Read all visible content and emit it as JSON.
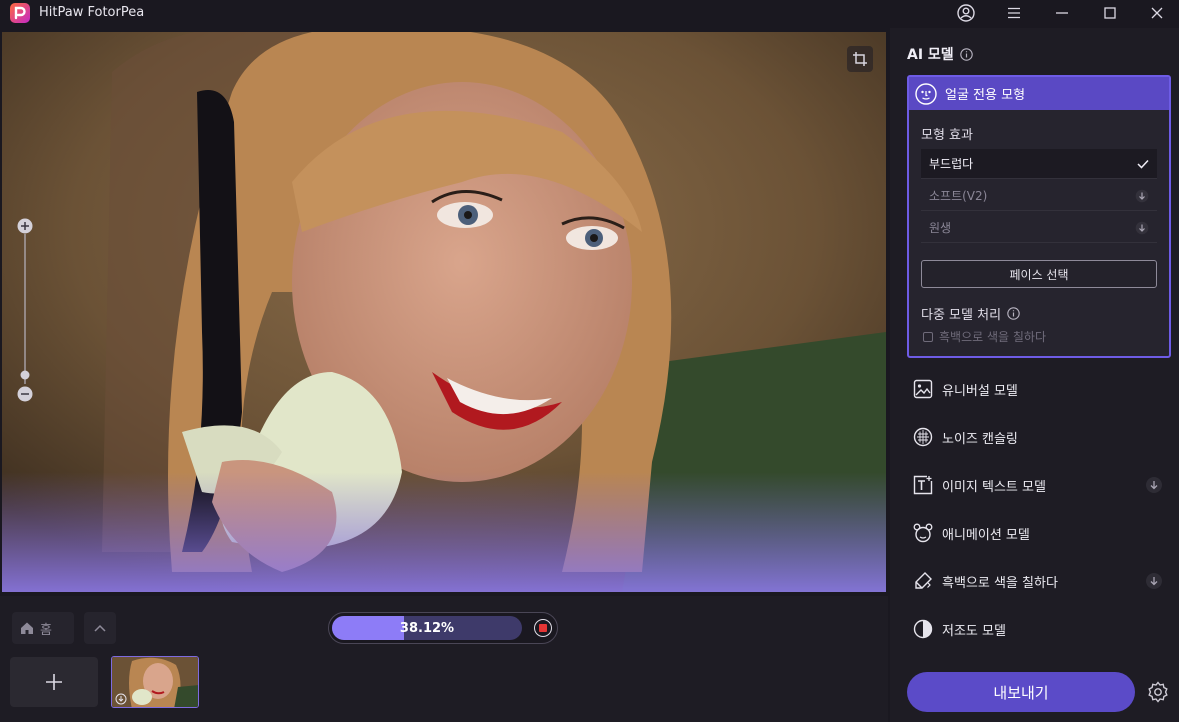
{
  "app": {
    "title": "HitPaw FotorPea"
  },
  "icons": {
    "logo": "hitpaw-logo-icon",
    "account": "account-icon",
    "menu": "menu-icon",
    "minimize": "minimize-icon",
    "maximize": "maximize-icon",
    "close": "close-icon",
    "crop": "crop-icon",
    "zoom_in": "zoom-in-icon",
    "zoom_out": "zoom-out-icon",
    "home": "home-icon",
    "chevron_up": "chevron-up-icon",
    "stop": "stop-icon",
    "add": "plus-icon",
    "info": "info-icon",
    "face": "face-icon",
    "check": "check-icon",
    "download": "download-icon",
    "settings": "gear-icon"
  },
  "colors": {
    "accent": "#5b4bc8",
    "accent_light": "#8d7cf7",
    "stop": "#e53535",
    "card_border": "#6e5ce6"
  },
  "bottom": {
    "home_label": "홈",
    "progress": {
      "value": 0.3812,
      "text": "38.12%"
    }
  },
  "panel": {
    "title": "AI 모델",
    "face_model": {
      "title": "얼굴 전용 모형",
      "effect_label": "모형 효과",
      "options": [
        {
          "label": "부드럽다",
          "state": "selected"
        },
        {
          "label": "소프트(V2)",
          "state": "download"
        },
        {
          "label": "원생",
          "state": "download"
        }
      ],
      "face_select_button": "페이스 선택",
      "multi_model_label": "다중 모델 처리",
      "bw_checkbox_label": "흑백으로 색을 칠하다",
      "bw_checked": false
    },
    "models": [
      {
        "label": "유니버설 모델",
        "icon": "image-icon",
        "download": false
      },
      {
        "label": "노이즈 캔슬링",
        "icon": "noise-icon",
        "download": false
      },
      {
        "label": "이미지 텍스트 모델",
        "icon": "text-image-icon",
        "download": true
      },
      {
        "label": "애니메이션 모델",
        "icon": "animation-icon",
        "download": false
      },
      {
        "label": "흑백으로 색을 칠하다",
        "icon": "colorize-icon",
        "download": true
      },
      {
        "label": "저조도 모델",
        "icon": "low-light-icon",
        "download": false
      }
    ],
    "export_label": "내보내기"
  }
}
